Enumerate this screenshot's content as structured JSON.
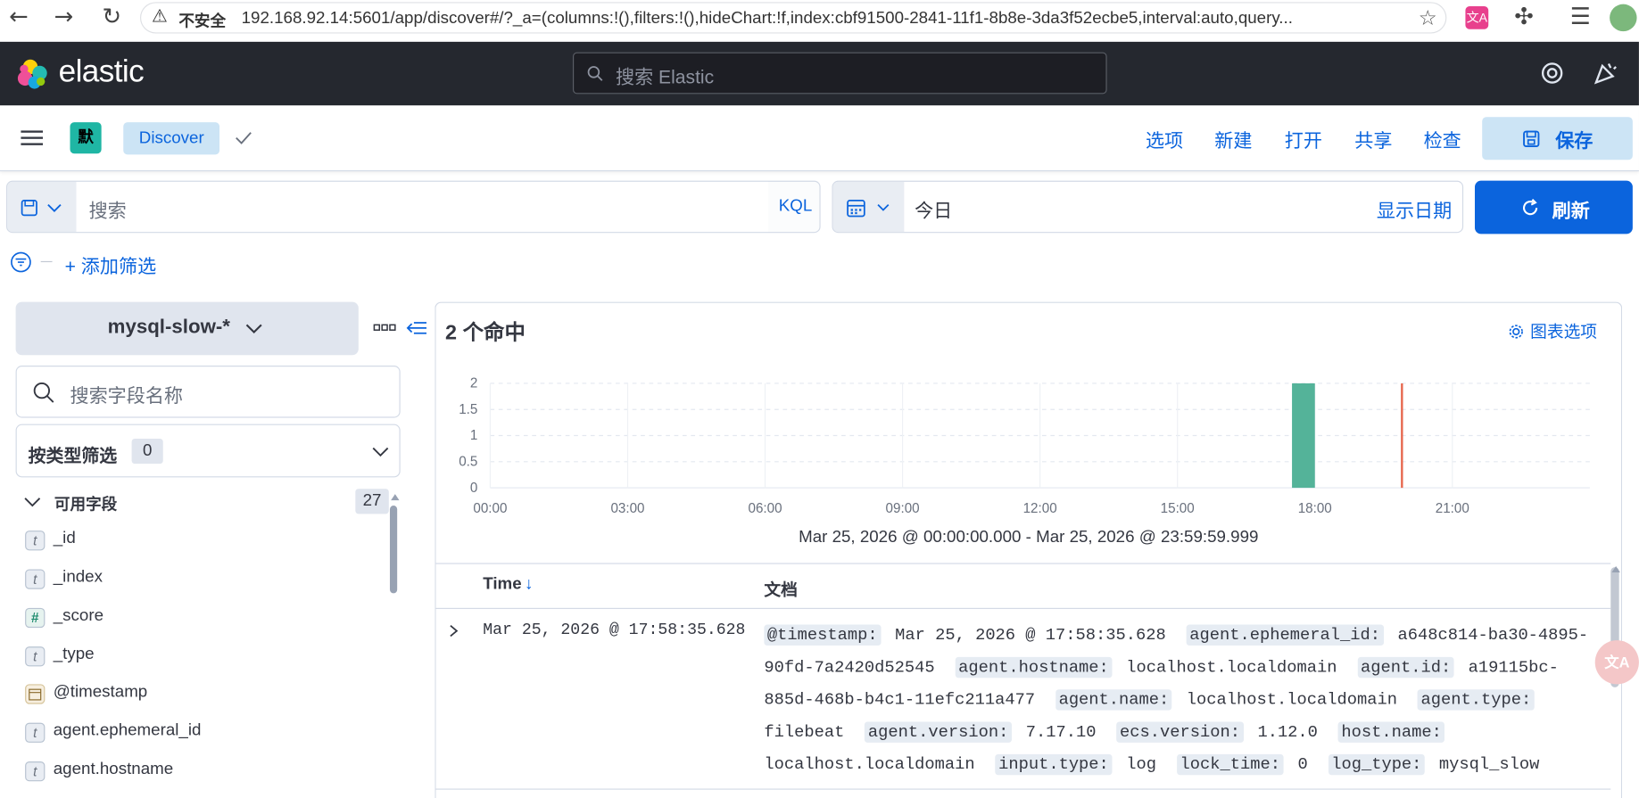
{
  "browser": {
    "security_label": "不安全",
    "url": "192.168.92.14:5601/app/discover#/?_a=(columns:!(),filters:!(),hideChart:!f,index:cbf91500-2841-11f1-8b8e-3da3f52ecbe5,interval:auto,query..."
  },
  "header": {
    "brand": "elastic",
    "search_placeholder": "搜索 Elastic"
  },
  "appbar": {
    "space_initial": "默",
    "breadcrumb": "Discover",
    "links": [
      "选项",
      "新建",
      "打开",
      "共享",
      "检查"
    ],
    "save_label": "保存"
  },
  "query": {
    "placeholder": "搜索",
    "language": "KQL",
    "date_value": "今日",
    "show_dates": "显示日期",
    "refresh_label": "刷新",
    "add_filter": "+ 添加筛选"
  },
  "sidebar": {
    "index_pattern": "mysql-slow-*",
    "field_search_placeholder": "搜索字段名称",
    "type_filter_label": "按类型筛选",
    "type_filter_count": "0",
    "available_label": "可用字段",
    "available_count": "27",
    "fields": [
      {
        "type": "t",
        "name": "_id"
      },
      {
        "type": "t",
        "name": "_index"
      },
      {
        "type": "#",
        "name": "_score"
      },
      {
        "type": "t",
        "name": "_type"
      },
      {
        "type": "date",
        "name": "@timestamp"
      },
      {
        "type": "t",
        "name": "agent.ephemeral_id"
      },
      {
        "type": "t",
        "name": "agent.hostname"
      }
    ]
  },
  "main": {
    "hits": "2 个命中",
    "chart_options": "图表选项",
    "time_range": "Mar 25, 2026 @ 00:00:00.000 - Mar 25, 2026 @ 23:59:59.999",
    "col_time": "Time",
    "col_doc": "文档",
    "row": {
      "time": "Mar 25, 2026 @ 17:58:35.628",
      "fields": [
        {
          "k": "@timestamp:",
          "v": "Mar 25, 2026 @ 17:58:35.628"
        },
        {
          "k": "agent.ephemeral_id:",
          "v": "a648c814-ba30-4895-90fd-7a2420d52545"
        },
        {
          "k": "agent.hostname:",
          "v": "localhost.localdomain"
        },
        {
          "k": "agent.id:",
          "v": "a19115bc-885d-468b-b4c1-11efc211a477"
        },
        {
          "k": "agent.name:",
          "v": "localhost.localdomain"
        },
        {
          "k": "agent.type:",
          "v": "filebeat"
        },
        {
          "k": "agent.version:",
          "v": "7.17.10"
        },
        {
          "k": "ecs.version:",
          "v": "1.12.0"
        },
        {
          "k": "host.name:",
          "v": "localhost.localdomain"
        },
        {
          "k": "input.type:",
          "v": "log"
        },
        {
          "k": "lock_time:",
          "v": "0"
        },
        {
          "k": "log_type:",
          "v": "mysql_slow"
        }
      ]
    }
  },
  "colors": {
    "accent": "#0b64dd",
    "bar": "#54b399",
    "now_line": "#e7664c",
    "header_bg": "#25282f"
  },
  "chart_data": {
    "type": "bar",
    "x_ticks": [
      "00:00",
      "03:00",
      "06:00",
      "09:00",
      "12:00",
      "15:00",
      "18:00",
      "21:00"
    ],
    "y_ticks": [
      "0",
      "0.5",
      "1",
      "1.5",
      "2"
    ],
    "ylim": [
      0,
      2
    ],
    "xlim_hours": [
      0,
      24
    ],
    "bars": [
      {
        "x_hour": 17.5,
        "width_hours": 0.5,
        "value": 2
      }
    ],
    "now_marker_hour": 19.9,
    "grid": true
  }
}
